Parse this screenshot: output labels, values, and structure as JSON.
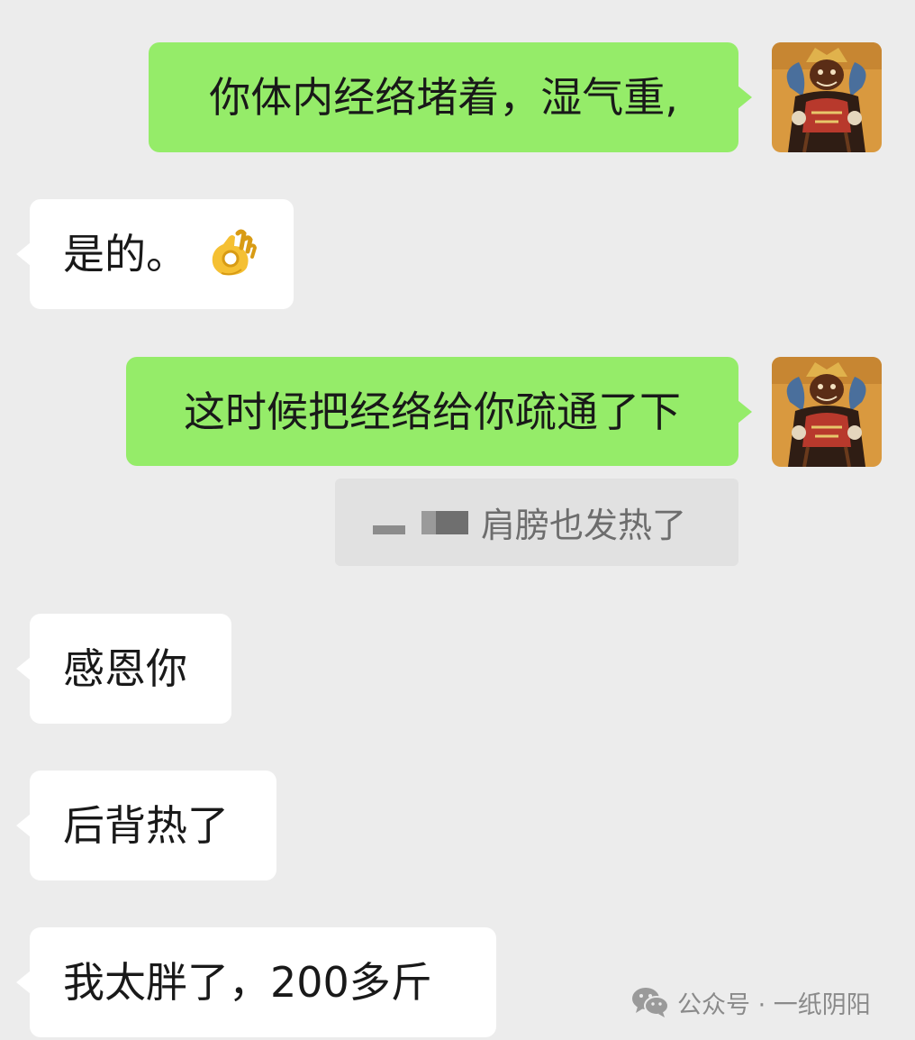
{
  "messages": [
    {
      "direction": "outgoing",
      "text": "你体内经络堵着，湿气重,"
    },
    {
      "direction": "incoming",
      "text": "是的。",
      "emoji": "ok-hand-emoji"
    },
    {
      "direction": "outgoing",
      "text": "这时候把经络给你疏通了下"
    },
    {
      "direction": "incoming-quote",
      "text": "肩膀也发热了"
    },
    {
      "direction": "incoming",
      "text": "感恩你"
    },
    {
      "direction": "incoming",
      "text": "后背热了"
    },
    {
      "direction": "incoming",
      "text": "我太胖了，200多斤"
    }
  ],
  "watermark": {
    "icon": "wechat-logo-icon",
    "text": "公众号 · 一纸阴阳"
  },
  "colors": {
    "background": "#ececec",
    "outgoing_bubble": "#95ec69",
    "incoming_bubble": "#ffffff",
    "quote_block": "#e1e1e1"
  }
}
